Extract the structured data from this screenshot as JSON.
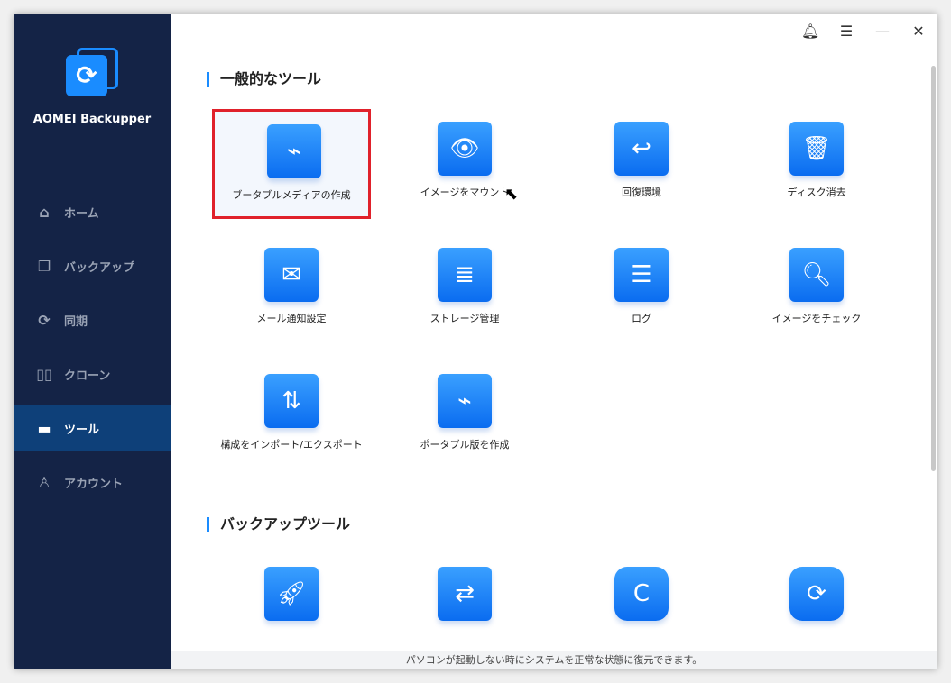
{
  "app": {
    "name": "AOMEI Backupper"
  },
  "sidebar": {
    "items": [
      {
        "label": "ホーム",
        "icon": "home-icon"
      },
      {
        "label": "バックアップ",
        "icon": "backup-icon"
      },
      {
        "label": "同期",
        "icon": "sync-icon"
      },
      {
        "label": "クローン",
        "icon": "clone-icon"
      },
      {
        "label": "ツール",
        "icon": "toolbox-icon",
        "active": true
      },
      {
        "label": "アカウント",
        "icon": "user-icon"
      }
    ]
  },
  "main": {
    "section1": "一般的なツール",
    "section2": "バックアップツール",
    "tools": [
      {
        "label": "ブータブルメディアの作成",
        "selected": true
      },
      {
        "label": "イメージをマウント"
      },
      {
        "label": "回復環境"
      },
      {
        "label": "ディスク消去"
      },
      {
        "label": "メール通知設定"
      },
      {
        "label": "ストレージ管理"
      },
      {
        "label": "ログ"
      },
      {
        "label": "イメージをチェック"
      },
      {
        "label": "構成をインポート/エクスポート"
      },
      {
        "label": "ポータブル版を作成"
      }
    ],
    "status": "パソコンが起動しない時にシステムを正常な状態に復元できます。"
  },
  "colors": {
    "sidebar": "#142346",
    "active": "#0e4079",
    "accent": "#1a8cff",
    "highlight": "#e0212b"
  }
}
